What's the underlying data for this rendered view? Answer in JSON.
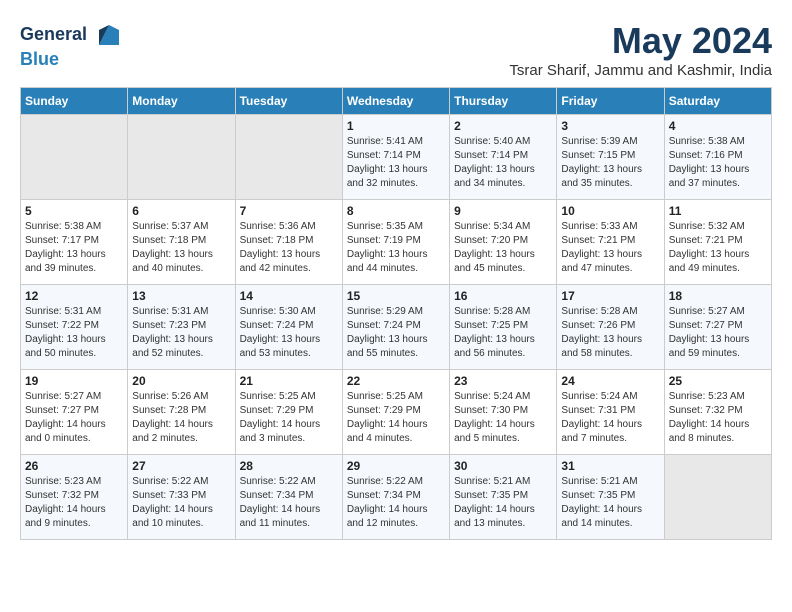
{
  "logo": {
    "line1": "General",
    "line2": "Blue"
  },
  "title": "May 2024",
  "subtitle": "Tsrar Sharif, Jammu and Kashmir, India",
  "weekdays": [
    "Sunday",
    "Monday",
    "Tuesday",
    "Wednesday",
    "Thursday",
    "Friday",
    "Saturday"
  ],
  "weeks": [
    [
      {
        "day": "",
        "empty": true
      },
      {
        "day": "",
        "empty": true
      },
      {
        "day": "",
        "empty": true
      },
      {
        "day": "1",
        "sunrise": "5:41 AM",
        "sunset": "7:14 PM",
        "daylight": "13 hours and 32 minutes."
      },
      {
        "day": "2",
        "sunrise": "5:40 AM",
        "sunset": "7:14 PM",
        "daylight": "13 hours and 34 minutes."
      },
      {
        "day": "3",
        "sunrise": "5:39 AM",
        "sunset": "7:15 PM",
        "daylight": "13 hours and 35 minutes."
      },
      {
        "day": "4",
        "sunrise": "5:38 AM",
        "sunset": "7:16 PM",
        "daylight": "13 hours and 37 minutes."
      }
    ],
    [
      {
        "day": "5",
        "sunrise": "5:38 AM",
        "sunset": "7:17 PM",
        "daylight": "13 hours and 39 minutes."
      },
      {
        "day": "6",
        "sunrise": "5:37 AM",
        "sunset": "7:18 PM",
        "daylight": "13 hours and 40 minutes."
      },
      {
        "day": "7",
        "sunrise": "5:36 AM",
        "sunset": "7:18 PM",
        "daylight": "13 hours and 42 minutes."
      },
      {
        "day": "8",
        "sunrise": "5:35 AM",
        "sunset": "7:19 PM",
        "daylight": "13 hours and 44 minutes."
      },
      {
        "day": "9",
        "sunrise": "5:34 AM",
        "sunset": "7:20 PM",
        "daylight": "13 hours and 45 minutes."
      },
      {
        "day": "10",
        "sunrise": "5:33 AM",
        "sunset": "7:21 PM",
        "daylight": "13 hours and 47 minutes."
      },
      {
        "day": "11",
        "sunrise": "5:32 AM",
        "sunset": "7:21 PM",
        "daylight": "13 hours and 49 minutes."
      }
    ],
    [
      {
        "day": "12",
        "sunrise": "5:31 AM",
        "sunset": "7:22 PM",
        "daylight": "13 hours and 50 minutes."
      },
      {
        "day": "13",
        "sunrise": "5:31 AM",
        "sunset": "7:23 PM",
        "daylight": "13 hours and 52 minutes."
      },
      {
        "day": "14",
        "sunrise": "5:30 AM",
        "sunset": "7:24 PM",
        "daylight": "13 hours and 53 minutes."
      },
      {
        "day": "15",
        "sunrise": "5:29 AM",
        "sunset": "7:24 PM",
        "daylight": "13 hours and 55 minutes."
      },
      {
        "day": "16",
        "sunrise": "5:28 AM",
        "sunset": "7:25 PM",
        "daylight": "13 hours and 56 minutes."
      },
      {
        "day": "17",
        "sunrise": "5:28 AM",
        "sunset": "7:26 PM",
        "daylight": "13 hours and 58 minutes."
      },
      {
        "day": "18",
        "sunrise": "5:27 AM",
        "sunset": "7:27 PM",
        "daylight": "13 hours and 59 minutes."
      }
    ],
    [
      {
        "day": "19",
        "sunrise": "5:27 AM",
        "sunset": "7:27 PM",
        "daylight": "14 hours and 0 minutes."
      },
      {
        "day": "20",
        "sunrise": "5:26 AM",
        "sunset": "7:28 PM",
        "daylight": "14 hours and 2 minutes."
      },
      {
        "day": "21",
        "sunrise": "5:25 AM",
        "sunset": "7:29 PM",
        "daylight": "14 hours and 3 minutes."
      },
      {
        "day": "22",
        "sunrise": "5:25 AM",
        "sunset": "7:29 PM",
        "daylight": "14 hours and 4 minutes."
      },
      {
        "day": "23",
        "sunrise": "5:24 AM",
        "sunset": "7:30 PM",
        "daylight": "14 hours and 5 minutes."
      },
      {
        "day": "24",
        "sunrise": "5:24 AM",
        "sunset": "7:31 PM",
        "daylight": "14 hours and 7 minutes."
      },
      {
        "day": "25",
        "sunrise": "5:23 AM",
        "sunset": "7:32 PM",
        "daylight": "14 hours and 8 minutes."
      }
    ],
    [
      {
        "day": "26",
        "sunrise": "5:23 AM",
        "sunset": "7:32 PM",
        "daylight": "14 hours and 9 minutes."
      },
      {
        "day": "27",
        "sunrise": "5:22 AM",
        "sunset": "7:33 PM",
        "daylight": "14 hours and 10 minutes."
      },
      {
        "day": "28",
        "sunrise": "5:22 AM",
        "sunset": "7:34 PM",
        "daylight": "14 hours and 11 minutes."
      },
      {
        "day": "29",
        "sunrise": "5:22 AM",
        "sunset": "7:34 PM",
        "daylight": "14 hours and 12 minutes."
      },
      {
        "day": "30",
        "sunrise": "5:21 AM",
        "sunset": "7:35 PM",
        "daylight": "14 hours and 13 minutes."
      },
      {
        "day": "31",
        "sunrise": "5:21 AM",
        "sunset": "7:35 PM",
        "daylight": "14 hours and 14 minutes."
      },
      {
        "day": "",
        "empty": true
      }
    ]
  ]
}
